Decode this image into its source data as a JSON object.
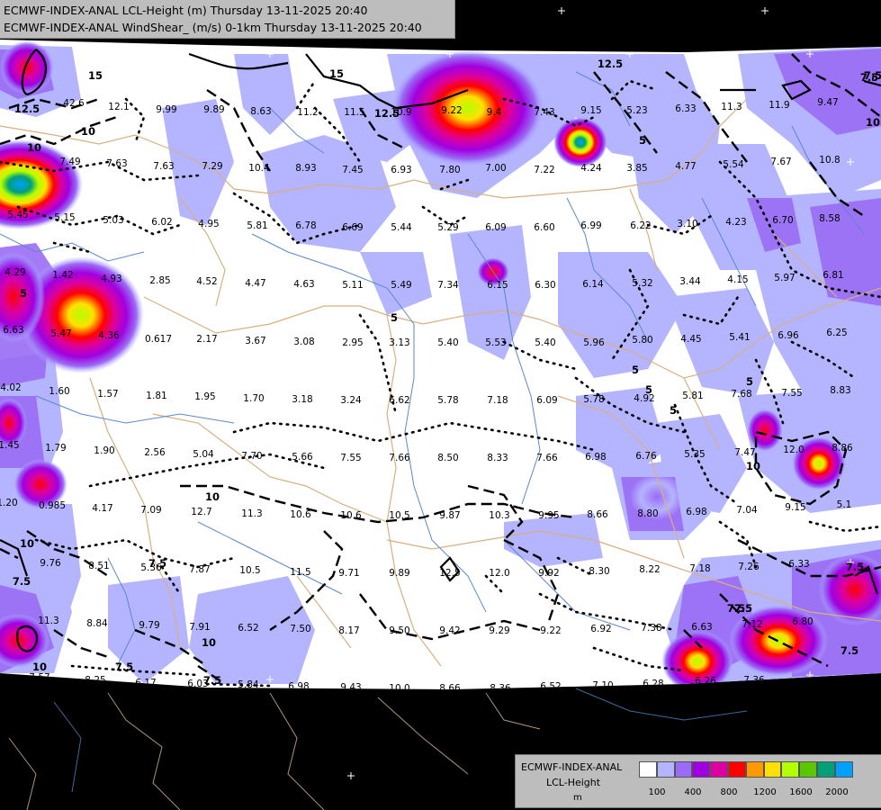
{
  "header": {
    "line1": "ECMWF-INDEX-ANAL LCL-Height (m) Thursday 13-11-2025 20:40",
    "line2": "ECMWF-INDEX-ANAL WindShear_ (m/s) 0-1km Thursday 13-11-2025 20:40"
  },
  "legend": {
    "model": "ECMWF-INDEX-ANAL",
    "parameter": "LCL-Height",
    "unit": "m",
    "colors": [
      "#ffffff",
      "#b4b4ff",
      "#9a6cf5",
      "#a000e0",
      "#dc00a0",
      "#ff0000",
      "#ff9900",
      "#ffe000",
      "#b4ff00",
      "#5ac800",
      "#00a078",
      "#00a0ff"
    ],
    "tick_labels": [
      "100",
      "400",
      "800",
      "1200",
      "1600",
      "2000"
    ]
  },
  "map_values": [
    [
      "42.6"
    ],
    [
      "12.1"
    ],
    [
      "9.99"
    ],
    [
      "9.89"
    ],
    [
      "8.63"
    ],
    [
      "11.2"
    ],
    [
      "11.5"
    ],
    [
      "10.9"
    ],
    [
      "9.22"
    ],
    [
      "9.4"
    ],
    [
      "7.43"
    ],
    [
      "9.15"
    ],
    [
      "5.23"
    ],
    [
      "6.33"
    ],
    [
      "11.3"
    ],
    [
      "11.9"
    ],
    [
      "9.47"
    ],
    [
      "7.49"
    ],
    [
      "7.63"
    ],
    [
      "7.63"
    ],
    [
      "7.29"
    ],
    [
      "10.4"
    ],
    [
      "8.93"
    ],
    [
      "7.45"
    ],
    [
      "6.93"
    ],
    [
      "7.80"
    ],
    [
      "7.00"
    ],
    [
      "7.22"
    ],
    [
      "4.24"
    ],
    [
      "3.85"
    ],
    [
      "4.77"
    ],
    [
      "5.54"
    ],
    [
      "7.67"
    ],
    [
      "10.8"
    ],
    [
      "5.45"
    ],
    [
      "5.15"
    ],
    [
      "5.03"
    ],
    [
      "6.02"
    ],
    [
      "4.95"
    ],
    [
      "5.81"
    ],
    [
      "6.78"
    ],
    [
      "6.69"
    ],
    [
      "5.44"
    ],
    [
      "5.29"
    ],
    [
      "6.09"
    ],
    [
      "6.60"
    ],
    [
      "6.99"
    ],
    [
      "6.22"
    ],
    [
      "3.10"
    ],
    [
      "4.23"
    ],
    [
      "6.70"
    ],
    [
      "8.58"
    ],
    [
      "4.29"
    ],
    [
      "1.42"
    ],
    [
      "4.93"
    ],
    [
      "2.85"
    ],
    [
      "4.52"
    ],
    [
      "4.47"
    ],
    [
      "4.63"
    ],
    [
      "5.11"
    ],
    [
      "5.49"
    ],
    [
      "7.34"
    ],
    [
      "6.15"
    ],
    [
      "6.30"
    ],
    [
      "6.14"
    ],
    [
      "5.32"
    ],
    [
      "3.44"
    ],
    [
      "4.15"
    ],
    [
      "5.97"
    ],
    [
      "6.81"
    ],
    [
      "6.63"
    ],
    [
      "5.47"
    ],
    [
      "4.36"
    ],
    [
      "0.617"
    ],
    [
      "2.17"
    ],
    [
      "3.67"
    ],
    [
      "3.08"
    ],
    [
      "2.95"
    ],
    [
      "3.13"
    ],
    [
      "5.40"
    ],
    [
      "5.53"
    ],
    [
      "5.40"
    ],
    [
      "5.96"
    ],
    [
      "5.80"
    ],
    [
      "4.45"
    ],
    [
      "5.41"
    ],
    [
      "6.96"
    ],
    [
      "6.25"
    ],
    [
      "4.02"
    ],
    [
      "1.60"
    ],
    [
      "1.57"
    ],
    [
      "1.81"
    ],
    [
      "1.95"
    ],
    [
      "1.70"
    ],
    [
      "3.18"
    ],
    [
      "3.24"
    ],
    [
      "6.62"
    ],
    [
      "5.78"
    ],
    [
      "7.18"
    ],
    [
      "6.09"
    ],
    [
      "5.78"
    ],
    [
      "4.92"
    ],
    [
      "5.81"
    ],
    [
      "7.68"
    ],
    [
      "7.55"
    ],
    [
      "8.83"
    ],
    [
      "1.45"
    ],
    [
      "1.79"
    ],
    [
      "1.90"
    ],
    [
      "2.56"
    ],
    [
      "5.04"
    ],
    [
      "7.70"
    ],
    [
      "5.66"
    ],
    [
      "7.55"
    ],
    [
      "7.66"
    ],
    [
      "8.50"
    ],
    [
      "8.33"
    ],
    [
      "7.66"
    ],
    [
      "6.98"
    ],
    [
      "6.76"
    ],
    [
      "5.35"
    ],
    [
      "7.47"
    ],
    [
      "12.0"
    ],
    [
      "8.86"
    ],
    [
      "1.20"
    ],
    [
      "0.985"
    ],
    [
      "4.17"
    ],
    [
      "7.09"
    ],
    [
      "12.7"
    ],
    [
      "11.3"
    ],
    [
      "10.6"
    ],
    [
      "10.6"
    ],
    [
      "10.5"
    ],
    [
      "9.87"
    ],
    [
      "10.3"
    ],
    [
      "9.95"
    ],
    [
      "8.66"
    ],
    [
      "8.80"
    ],
    [
      "6.98"
    ],
    [
      "7.04"
    ],
    [
      "9.15"
    ],
    [
      "5.1"
    ],
    [
      "9.76"
    ],
    [
      "8.51"
    ],
    [
      "5.36"
    ],
    [
      "7.87"
    ],
    [
      "10.5"
    ],
    [
      "11.5"
    ],
    [
      "9.71"
    ],
    [
      "9.89"
    ],
    [
      "12.5"
    ],
    [
      "12.0"
    ],
    [
      "9.92"
    ],
    [
      "8.30"
    ],
    [
      "8.22"
    ],
    [
      "7.18"
    ],
    [
      "7.26"
    ],
    [
      "6.33"
    ],
    [
      "11.3"
    ],
    [
      "8.84"
    ],
    [
      "9.79"
    ],
    [
      "7.91"
    ],
    [
      "6.52"
    ],
    [
      "7.50"
    ],
    [
      "8.17"
    ],
    [
      "9.50"
    ],
    [
      "9.42"
    ],
    [
      "9.29"
    ],
    [
      "9.22"
    ],
    [
      "6.92"
    ],
    [
      "7.38"
    ],
    [
      "6.63"
    ],
    [
      "7.12"
    ],
    [
      "6.80"
    ],
    [
      "7.57"
    ],
    [
      "8.25"
    ],
    [
      "6.17"
    ],
    [
      "6.03"
    ],
    [
      "5.84"
    ],
    [
      "6.98"
    ],
    [
      "9.43"
    ],
    [
      "10.0"
    ],
    [
      "8.66"
    ],
    [
      "8.36"
    ],
    [
      "6.52"
    ],
    [
      "7.10"
    ],
    [
      "6.28"
    ],
    [
      "6.26"
    ],
    [
      "7.36"
    ]
  ],
  "contour_labels": [
    "15",
    "15",
    "12.5",
    "12.5",
    "10",
    "7.5",
    "5",
    "5",
    "12.5",
    "7.5",
    "10",
    "5",
    "5",
    "5",
    "5",
    "5",
    "7.5",
    "10",
    "10",
    "7.5",
    "7.5",
    "10",
    "7.5",
    "7.5",
    "7.5",
    "7.5",
    "10",
    "7.5",
    "10",
    "10"
  ]
}
